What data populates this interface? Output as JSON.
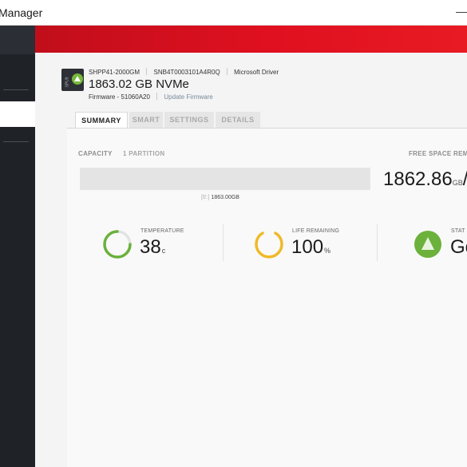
{
  "window": {
    "title": "Manager",
    "minimize_glyph": "—"
  },
  "drive": {
    "model": "SHPP41-2000GM",
    "serial": "SNB4T0003101A4R0Q",
    "driver": "Microsoft Driver",
    "capacity_title": "1863.02 GB NVMe",
    "firmware": "Firmware - 51060A20",
    "update_firmware_label": "Update Firmware",
    "icon_label": "SPU9"
  },
  "tabs": [
    {
      "label": "SUMMARY",
      "active": true
    },
    {
      "label": "SMART",
      "active": false
    },
    {
      "label": "SETTINGS",
      "active": false
    },
    {
      "label": "DETAILS",
      "active": false
    }
  ],
  "summary": {
    "capacity_label": "CAPACITY",
    "partition_label": "1 PARTITION",
    "free_space_label": "FREE SPACE REM",
    "partition_drive": "[E:]",
    "partition_size": "1863.00GB",
    "used_fraction": 0,
    "free_value": "1862.86",
    "free_unit": "GB",
    "free_sep": "/"
  },
  "stats": {
    "temperature": {
      "label": "TEMPERATURE",
      "value": "38",
      "unit": "c",
      "color": "#6bb13b"
    },
    "life": {
      "label": "LIFE REMAINING",
      "value": "100",
      "unit": "%",
      "color": "#f0b929"
    },
    "status": {
      "label": "STAT",
      "value": "Go",
      "color": "#6bb13b"
    }
  },
  "colors": {
    "header_red": "#e01020",
    "sidebar": "#1f2328",
    "accent_green": "#6bb13b",
    "accent_yellow": "#f0b929"
  }
}
